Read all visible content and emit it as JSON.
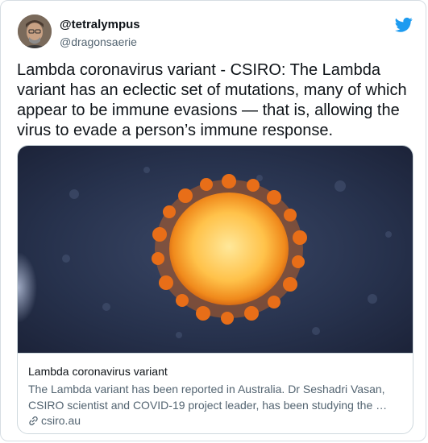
{
  "user": {
    "display_handle": "@tetralympus",
    "username": "@dragonsaerie"
  },
  "tweet": {
    "text": "Lambda coronavirus variant - CSIRO: The Lambda variant has an eclectic set of mutations, many of which appear to be immune evasions — that is, allowing the virus to evade a person’s immune response."
  },
  "card": {
    "title": "Lambda coronavirus variant",
    "description": "The Lambda variant has been reported in Australia. Dr Seshadri Vasan, CSIRO scientist and COVID-19 project leader, has been studying the …",
    "domain": "csiro.au"
  },
  "icons": {
    "brand": "twitter-bird-icon",
    "link": "link-icon"
  },
  "colors": {
    "brand": "#1d9bf0",
    "text": "#0f1419",
    "muted": "#536471",
    "border": "#cfd9de"
  }
}
